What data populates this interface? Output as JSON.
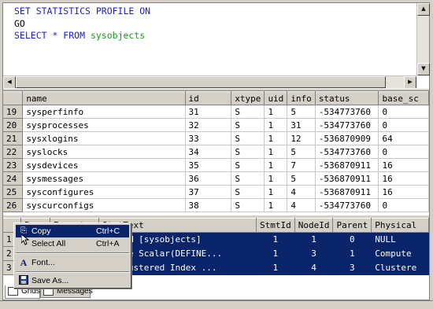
{
  "editor": {
    "line1": "SET STATISTICS PROFILE ON",
    "line2": "GO",
    "line3_kw": "SELECT * FROM",
    "line3_obj": "sysobjects"
  },
  "grid1": {
    "columns": [
      "name",
      "id",
      "xtype",
      "uid",
      "info",
      "status",
      "base_sc"
    ],
    "rows": [
      [
        "19",
        "sysperfinfo",
        "31",
        "S",
        "1",
        "5",
        "-534773760",
        "0"
      ],
      [
        "20",
        "sysprocesses",
        "32",
        "S",
        "1",
        "31",
        "-534773760",
        "0"
      ],
      [
        "21",
        "sysxlogins",
        "33",
        "S",
        "1",
        "12",
        "-536870909",
        "64"
      ],
      [
        "22",
        "syslocks",
        "34",
        "S",
        "1",
        "5",
        "-534773760",
        "0"
      ],
      [
        "23",
        "sysdevices",
        "35",
        "S",
        "1",
        "7",
        "-536870911",
        "16"
      ],
      [
        "24",
        "sysmessages",
        "36",
        "S",
        "1",
        "5",
        "-536870911",
        "16"
      ],
      [
        "25",
        "sysconfigures",
        "37",
        "S",
        "1",
        "4",
        "-536870911",
        "16"
      ],
      [
        "26",
        "syscurconfigs",
        "38",
        "S",
        "1",
        "4",
        "-534773760",
        "0"
      ]
    ]
  },
  "grid2": {
    "columns": [
      "Rows",
      "Executes",
      "StmtText",
      "StmtId",
      "NodeId",
      "Parent",
      "Physical"
    ],
    "rows": [
      [
        "1",
        "",
        "",
        "* FROM [sysobjects]",
        "1",
        "1",
        "0",
        "NULL"
      ],
      [
        "2",
        "",
        "",
        "ompute Scalar(DEFINE...",
        "1",
        "3",
        "1",
        "Compute"
      ],
      [
        "3",
        "",
        "",
        "|--Clustered Index ...",
        "1",
        "4",
        "3",
        "Clustere"
      ]
    ]
  },
  "context_menu": {
    "copy": {
      "label": "Copy",
      "shortcut": "Ctrl+C"
    },
    "select_all": {
      "label": "Select All",
      "shortcut": "Ctrl+A"
    },
    "font": {
      "label": "Font..."
    },
    "save_as": {
      "label": "Save As..."
    }
  },
  "tabs": {
    "grids": "Grids",
    "messages": "Messages"
  }
}
